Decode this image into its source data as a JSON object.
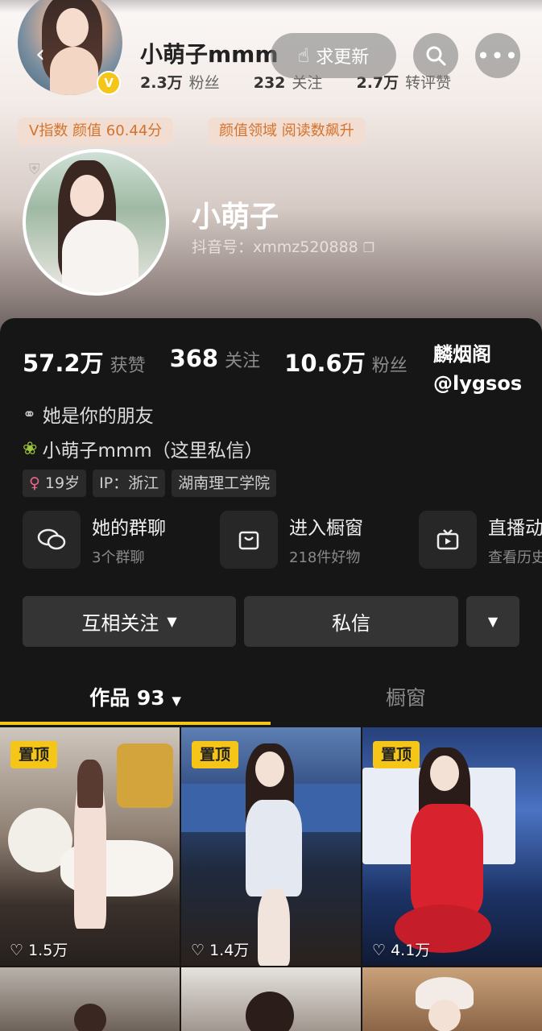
{
  "header": {
    "account_name": "小萌子mmm",
    "followers_value": "2.3万",
    "followers_label": "粉丝",
    "following_value": "232",
    "following_label": "关注",
    "likes_value": "2.7万",
    "likes_label": "转评赞",
    "update_button": "求更新",
    "tag1": "V指数 颜值 60.44分",
    "tag2": "颜值领域 阅读数飙升"
  },
  "profile": {
    "name": "小萌子",
    "douyin_id": "抖音号：xmmz520888"
  },
  "stats": [
    {
      "value": "57.2万",
      "label": "获赞"
    },
    {
      "value": "368",
      "label": "关注"
    },
    {
      "value": "10.6万",
      "label": "粉丝"
    }
  ],
  "watermark": {
    "line1": "麟烟阁",
    "line2": "@lygsos"
  },
  "friend_text": "她是你的朋友",
  "message_text": "小萌子mmm（这里私信）",
  "info_tags": [
    "19岁",
    "IP：浙江",
    "湖南理工学院"
  ],
  "quick_links": [
    {
      "title": "她的群聊",
      "subtitle": "3个群聊"
    },
    {
      "title": "进入橱窗",
      "subtitle": "218件好物"
    },
    {
      "title": "直播动",
      "subtitle": "查看历史"
    }
  ],
  "buttons": {
    "follow": "互相关注",
    "message": "私信"
  },
  "tabs": {
    "works": "作品 93",
    "showcase": "橱窗"
  },
  "videos": [
    {
      "badge": "置顶",
      "likes": "1.5万"
    },
    {
      "badge": "置顶",
      "likes": "1.4万"
    },
    {
      "badge": "置顶",
      "likes": "4.1万"
    }
  ],
  "colors": {
    "accent": "#f5c518",
    "background": "#161616",
    "tag_text": "#d6732b"
  }
}
